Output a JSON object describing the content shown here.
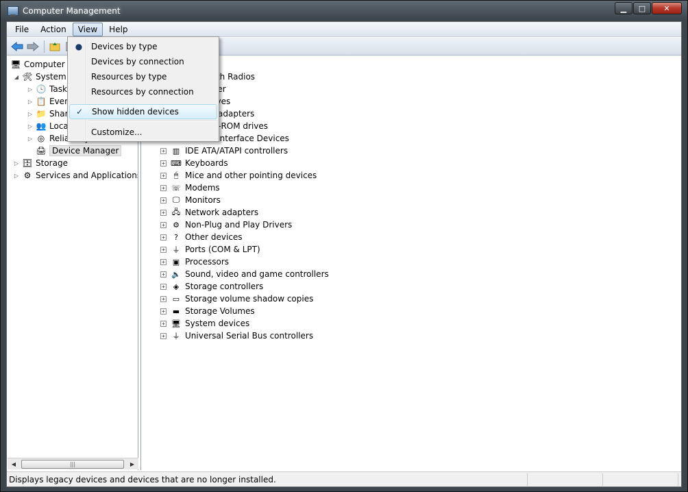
{
  "window": {
    "title": "Computer Management",
    "controls": {
      "minimize": "▁",
      "maximize": "□",
      "close": "✕"
    }
  },
  "menubar": {
    "items": [
      {
        "label": "File"
      },
      {
        "label": "Action"
      },
      {
        "label": "View",
        "active": true
      },
      {
        "label": "Help"
      }
    ]
  },
  "toolbar": {
    "icons": [
      "back-arrow-icon",
      "forward-arrow-icon",
      "up-folder-icon",
      "show-hide-tree-icon"
    ]
  },
  "left_tree": {
    "items": [
      {
        "label": "Computer Management (Local)",
        "icon": "computer-icon"
      },
      {
        "label": "System Tools",
        "icon": "tools-icon",
        "expanded": true
      },
      {
        "label": "Task Scheduler",
        "icon": "clock-icon"
      },
      {
        "label": "Event Viewer",
        "icon": "event-viewer-icon"
      },
      {
        "label": "Shared Folders",
        "icon": "shared-folders-icon"
      },
      {
        "label": "Local Users and Groups",
        "icon": "users-icon"
      },
      {
        "label": "Reliability and Performance",
        "icon": "performance-icon"
      },
      {
        "label": "Device Manager",
        "icon": "device-manager-icon",
        "selected": true
      },
      {
        "label": "Storage",
        "icon": "storage-icon"
      },
      {
        "label": "Services and Applications",
        "icon": "services-icon"
      }
    ]
  },
  "devices": {
    "items": [
      {
        "label": "Bluetooth Radios",
        "icon": "bluetooth-icon"
      },
      {
        "label": "Computer",
        "icon": "computer-icon"
      },
      {
        "label": "Disk drives",
        "icon": "disk-drive-icon"
      },
      {
        "label": "Display adapters",
        "icon": "display-adapter-icon"
      },
      {
        "label": "DVD/CD-ROM drives",
        "icon": "dvd-drive-icon"
      },
      {
        "label": "Human Interface Devices",
        "icon": "hid-icon"
      },
      {
        "label": "IDE ATA/ATAPI controllers",
        "icon": "ide-controller-icon"
      },
      {
        "label": "Keyboards",
        "icon": "keyboard-icon"
      },
      {
        "label": "Mice and other pointing devices",
        "icon": "mouse-icon"
      },
      {
        "label": "Modems",
        "icon": "modem-icon"
      },
      {
        "label": "Monitors",
        "icon": "monitor-icon"
      },
      {
        "label": "Network adapters",
        "icon": "network-adapter-icon"
      },
      {
        "label": "Non-Plug and Play Drivers",
        "icon": "driver-icon"
      },
      {
        "label": "Other devices",
        "icon": "unknown-device-icon"
      },
      {
        "label": "Ports (COM & LPT)",
        "icon": "port-icon"
      },
      {
        "label": "Processors",
        "icon": "processor-icon"
      },
      {
        "label": "Sound, video and game controllers",
        "icon": "speaker-icon"
      },
      {
        "label": "Storage controllers",
        "icon": "storage-controller-icon"
      },
      {
        "label": "Storage volume shadow copies",
        "icon": "shadow-copy-icon"
      },
      {
        "label": "Storage Volumes",
        "icon": "volume-icon"
      },
      {
        "label": "System devices",
        "icon": "system-device-icon"
      },
      {
        "label": "Universal Serial Bus controllers",
        "icon": "usb-icon"
      }
    ]
  },
  "view_menu": {
    "items": [
      {
        "label": "Devices by type",
        "mark": "●"
      },
      {
        "label": "Devices by connection",
        "mark": ""
      },
      {
        "label": "Resources by type",
        "mark": ""
      },
      {
        "label": "Resources by connection",
        "mark": ""
      },
      {
        "label": "Show hidden devices",
        "mark": "✓",
        "highlighted": true
      },
      {
        "label": "Customize...",
        "mark": ""
      }
    ]
  },
  "statusbar": {
    "text": "Displays legacy devices and devices that are no longer installed."
  },
  "scrollbar": {
    "left": "◀",
    "right": "▶",
    "grip": "|||"
  }
}
